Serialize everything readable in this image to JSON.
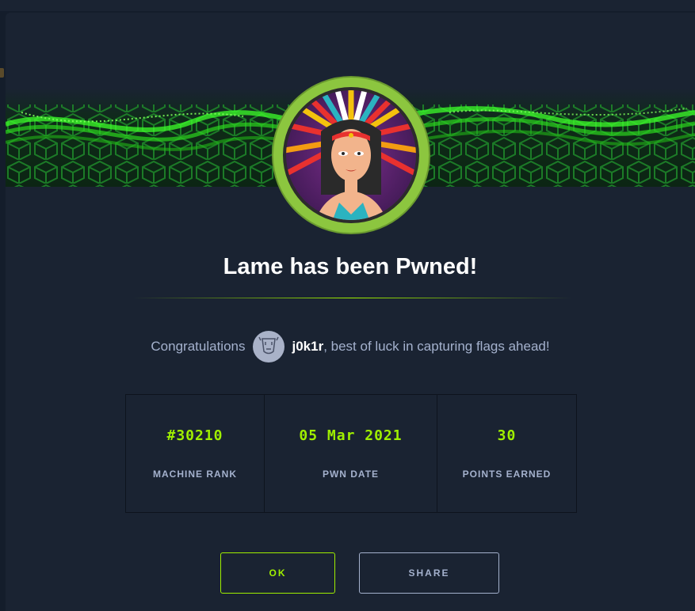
{
  "modal": {
    "title": "Lame has been Pwned!",
    "congrats_text": "Congratulations",
    "username": "j0k1r",
    "congrats_suffix": ", best of luck in capturing flags ahead!",
    "avatar_icon": "machine-avatar-icon",
    "user_avatar_icon": "user-avatar-icon"
  },
  "stats": [
    {
      "value": "#30210",
      "label": "MACHINE RANK"
    },
    {
      "value": "05 Mar 2021",
      "label": "PWN DATE"
    },
    {
      "value": "30",
      "label": "POINTS EARNED"
    }
  ],
  "buttons": {
    "ok_label": "OK",
    "share_label": "SHARE"
  },
  "colors": {
    "accent": "#9fef00",
    "background": "#1a2332",
    "text_muted": "#a4b1cd"
  }
}
